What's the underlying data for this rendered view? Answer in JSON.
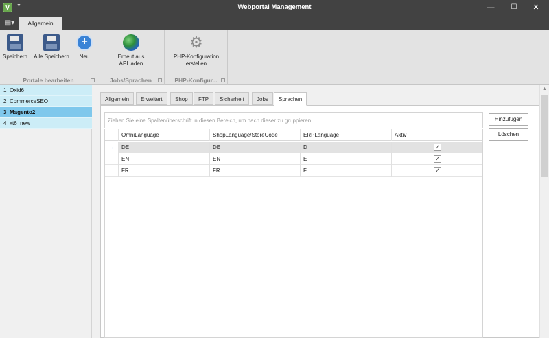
{
  "window": {
    "title": "Webportal Management",
    "minimize": "—",
    "maximize": "☐",
    "close": "✕",
    "app_icon": "V"
  },
  "ribbon": {
    "tabs": [
      {
        "label": "Allgemein"
      }
    ],
    "groups": [
      {
        "label": "Portale bearbeiten",
        "buttons": [
          {
            "label": "Speichern",
            "icon": "floppy-icon"
          },
          {
            "label": "Alle Speichern",
            "icon": "floppy-icon"
          },
          {
            "label": "Neu",
            "icon": "plus-icon"
          }
        ]
      },
      {
        "label": "Jobs/Sprachen",
        "buttons": [
          {
            "label_line1": "Erneut aus",
            "label_line2": "API laden",
            "icon": "globe-icon"
          }
        ]
      },
      {
        "label": "PHP-Konfigur...",
        "buttons": [
          {
            "label_line1": "PHP-Konfiguration",
            "label_line2": "erstellen",
            "icon": "gears-icon"
          }
        ]
      }
    ]
  },
  "portals": [
    {
      "num": "1",
      "name": "Oxid6"
    },
    {
      "num": "2",
      "name": "CommerceSEO"
    },
    {
      "num": "3",
      "name": "Magento2",
      "selected": true
    },
    {
      "num": "4",
      "name": "xt6_new"
    }
  ],
  "page_tabs": [
    "Allgemein",
    "Erweitert",
    "Shop",
    "FTP",
    "Sicherheit",
    "Jobs",
    "Sprachen"
  ],
  "active_tab": "Sprachen",
  "grid": {
    "group_hint": "Ziehen Sie eine Spaltenüberschrift in diesen Bereich, um nach dieser zu gruppieren",
    "columns": [
      "OmniLanguage",
      "ShopLanguage/StoreCode",
      "ERPLanguage",
      "Aktiv"
    ],
    "rows": [
      {
        "omni": "DE",
        "shop": "DE",
        "erp": "D",
        "aktiv": "✓"
      },
      {
        "omni": "EN",
        "shop": "EN",
        "erp": "E",
        "aktiv": "✓"
      },
      {
        "omni": "FR",
        "shop": "FR",
        "erp": "F",
        "aktiv": "✓"
      }
    ],
    "focus_indicator": "→"
  },
  "side_buttons": {
    "add": "Hinzufügen",
    "delete": "Löschen"
  }
}
